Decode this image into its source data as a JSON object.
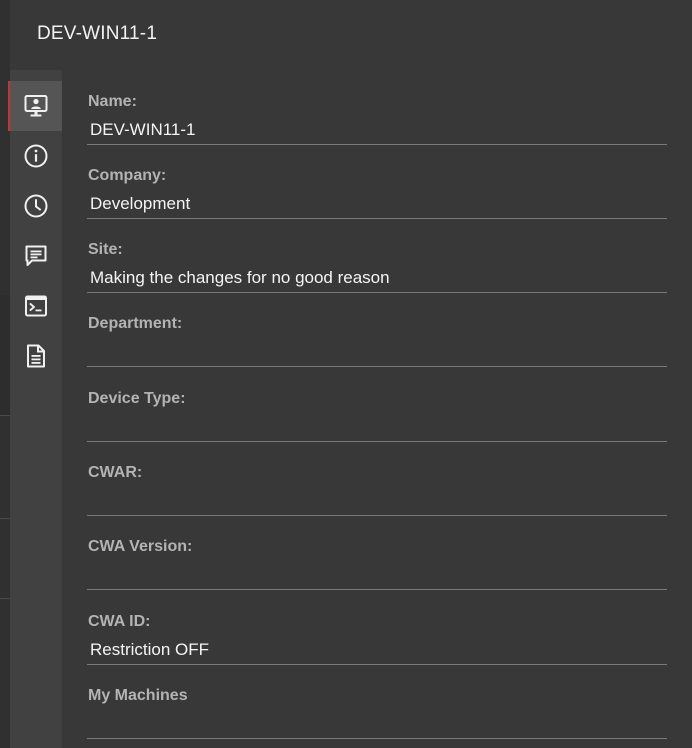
{
  "header": {
    "title": "DEV-WIN11-1"
  },
  "rail": {
    "items": [
      {
        "icon": "monitor-user-icon",
        "active": true
      },
      {
        "icon": "info-icon",
        "active": false
      },
      {
        "icon": "clock-icon",
        "active": false
      },
      {
        "icon": "chat-icon",
        "active": false
      },
      {
        "icon": "terminal-icon",
        "active": false
      },
      {
        "icon": "document-icon",
        "active": false
      }
    ]
  },
  "fields": {
    "name": {
      "label": "Name:",
      "value": "DEV-WIN11-1"
    },
    "company": {
      "label": "Company:",
      "value": "Development"
    },
    "site": {
      "label": "Site:",
      "value": "Making the changes for no good reason"
    },
    "department": {
      "label": "Department:",
      "value": ""
    },
    "device_type": {
      "label": "Device Type:",
      "value": ""
    },
    "cwar": {
      "label": "CWAR:",
      "value": ""
    },
    "cwa_version": {
      "label": "CWA Version:",
      "value": ""
    },
    "cwa_id": {
      "label": "CWA ID:",
      "value": "Restriction OFF"
    },
    "my_machines": {
      "label": "My Machines",
      "value": ""
    }
  },
  "colors": {
    "background": "#383838",
    "rail": "#414141",
    "active_item": "#555555",
    "accent": "#c0392b",
    "label": "#b3b3b3",
    "value": "#f4f4f4"
  }
}
